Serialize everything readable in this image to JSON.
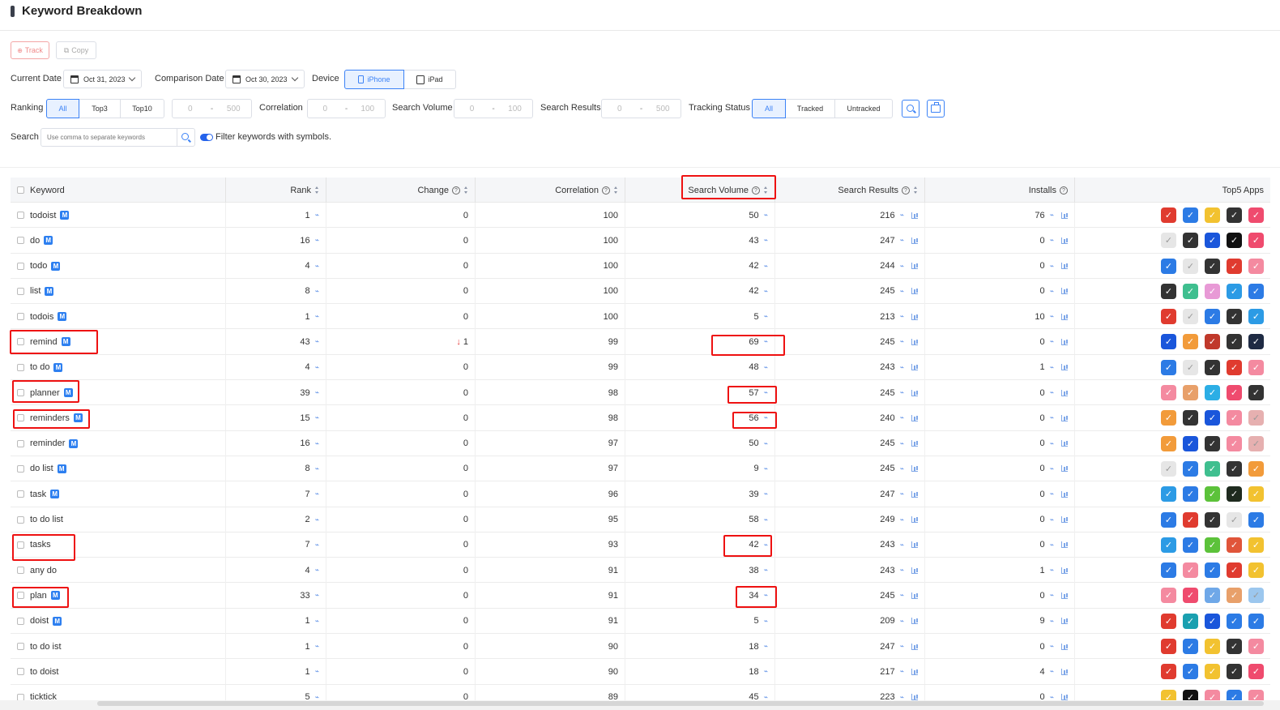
{
  "page": {
    "title": "Keyword Breakdown"
  },
  "toolbar": {
    "track_label": "Track",
    "copy_label": "Copy"
  },
  "filters": {
    "current_date_label": "Current Date",
    "current_date": "Oct 31, 2023",
    "comparison_date_label": "Comparison Date",
    "comparison_date": "Oct 30, 2023",
    "device_label": "Device",
    "device_options": [
      "iPhone",
      "iPad"
    ],
    "ranking_label": "Ranking",
    "ranking_options": [
      "All",
      "Top3",
      "Top10"
    ],
    "ranking_min": "0",
    "ranking_max": "500",
    "correlation_label": "Correlation",
    "correlation_min": "0",
    "correlation_max": "100",
    "search_volume_label": "Search Volume",
    "search_volume_min": "0",
    "search_volume_max": "100",
    "search_results_label": "Search Results",
    "search_results_min": "0",
    "search_results_max": "500",
    "tracking_status_label": "Tracking Status",
    "tracking_options": [
      "All",
      "Tracked",
      "Untracked"
    ],
    "range_dash": "-",
    "search_label": "Search",
    "search_placeholder": "Use comma to separate keywords",
    "filter_symbols_label": "Filter keywords with symbols."
  },
  "table": {
    "columns": [
      "Keyword",
      "Rank",
      "Change",
      "Correlation",
      "Search Volume",
      "Search Results",
      "Installs",
      "Top5 Apps"
    ],
    "rows": [
      {
        "keyword": "todoist",
        "m": "M",
        "rank": "1",
        "change": "0",
        "correlation": "100",
        "volume": "50",
        "results": "216",
        "installs": "76",
        "apps": [
          "#e03b2f",
          "#2c7be5",
          "#f2c230",
          "#333333",
          "#ef4b6e"
        ]
      },
      {
        "keyword": "do",
        "m": "M",
        "rank": "16",
        "change": "0",
        "correlation": "100",
        "volume": "43",
        "results": "247",
        "installs": "0",
        "apps": [
          "#e6e6e6",
          "#333333",
          "#1a56db",
          "#111111",
          "#ef4b6e"
        ]
      },
      {
        "keyword": "todo",
        "m": "M",
        "rank": "4",
        "change": "0",
        "correlation": "100",
        "volume": "42",
        "results": "244",
        "installs": "0",
        "apps": [
          "#2c7be5",
          "#e6e6e6",
          "#333333",
          "#e03b2f",
          "#f48aa0"
        ]
      },
      {
        "keyword": "list",
        "m": "M",
        "rank": "8",
        "change": "0",
        "correlation": "100",
        "volume": "42",
        "results": "245",
        "installs": "0",
        "apps": [
          "#333333",
          "#3fbf8f",
          "#e89ad6",
          "#2c9be5",
          "#2c7be5"
        ]
      },
      {
        "keyword": "todois",
        "m": "M",
        "rank": "1",
        "change": "0",
        "correlation": "100",
        "volume": "5",
        "results": "213",
        "installs": "10",
        "apps": [
          "#e03b2f",
          "#e6e6e6",
          "#2c7be5",
          "#333333",
          "#2c9be5"
        ]
      },
      {
        "keyword": "remind",
        "m": "M",
        "rank": "43",
        "change": "1",
        "change_down": "↓",
        "correlation": "99",
        "volume": "69",
        "results": "245",
        "installs": "0",
        "apps": [
          "#1a56db",
          "#f29b3a",
          "#c0392b",
          "#333333",
          "#1f2b44"
        ]
      },
      {
        "keyword": "to do",
        "m": "M",
        "rank": "4",
        "change": "0",
        "correlation": "99",
        "volume": "48",
        "results": "243",
        "installs": "1",
        "apps": [
          "#2c7be5",
          "#e6e6e6",
          "#333333",
          "#e03b2f",
          "#f48aa0"
        ]
      },
      {
        "keyword": "planner",
        "m": "M",
        "rank": "39",
        "change": "0",
        "correlation": "98",
        "volume": "57",
        "results": "245",
        "installs": "0",
        "apps": [
          "#f48aa0",
          "#e8a06a",
          "#2caee5",
          "#ef4b6e",
          "#333333"
        ]
      },
      {
        "keyword": "reminders",
        "m": "M",
        "rank": "15",
        "change": "0",
        "correlation": "98",
        "volume": "56",
        "results": "240",
        "installs": "0",
        "apps": [
          "#f29b3a",
          "#333333",
          "#1a56db",
          "#f48aa0",
          "#e6b0b0"
        ]
      },
      {
        "keyword": "reminder",
        "m": "M",
        "rank": "16",
        "change": "0",
        "correlation": "97",
        "volume": "50",
        "results": "245",
        "installs": "0",
        "apps": [
          "#f29b3a",
          "#1a56db",
          "#333333",
          "#f48aa0",
          "#e6b0b0"
        ]
      },
      {
        "keyword": "do list",
        "m": "M",
        "rank": "8",
        "change": "0",
        "correlation": "97",
        "volume": "9",
        "results": "245",
        "installs": "0",
        "apps": [
          "#e6e6e6",
          "#2c7be5",
          "#3fbf8f",
          "#333333",
          "#f29b3a"
        ]
      },
      {
        "keyword": "task",
        "m": "M",
        "rank": "7",
        "change": "0",
        "correlation": "96",
        "volume": "39",
        "results": "247",
        "installs": "0",
        "apps": [
          "#2c9be5",
          "#2c7be5",
          "#5cc23a",
          "#1f2b1f",
          "#f2c230"
        ]
      },
      {
        "keyword": "to do list",
        "m": "",
        "rank": "2",
        "change": "0",
        "correlation": "95",
        "volume": "58",
        "results": "249",
        "installs": "0",
        "apps": [
          "#2c7be5",
          "#e03b2f",
          "#333333",
          "#e6e6e6",
          "#2c7be5"
        ]
      },
      {
        "keyword": "tasks",
        "m": "",
        "rank": "7",
        "change": "0",
        "correlation": "93",
        "volume": "42",
        "results": "243",
        "installs": "0",
        "apps": [
          "#2c9be5",
          "#2c7be5",
          "#5cc23a",
          "#e0553a",
          "#f2c230"
        ]
      },
      {
        "keyword": "any do",
        "m": "",
        "rank": "4",
        "change": "0",
        "correlation": "91",
        "volume": "38",
        "results": "243",
        "installs": "1",
        "apps": [
          "#2c7be5",
          "#f48aa0",
          "#2c7be5",
          "#e03b2f",
          "#f2c230"
        ]
      },
      {
        "keyword": "plan",
        "m": "M",
        "rank": "33",
        "change": "0",
        "correlation": "91",
        "volume": "34",
        "results": "245",
        "installs": "0",
        "apps": [
          "#f48aa0",
          "#ef4b6e",
          "#6fa8e8",
          "#e8a06a",
          "#9cc7ee"
        ]
      },
      {
        "keyword": "doist",
        "m": "M",
        "rank": "1",
        "change": "0",
        "correlation": "91",
        "volume": "5",
        "results": "209",
        "installs": "9",
        "apps": [
          "#e03b2f",
          "#1aa0b0",
          "#1a56db",
          "#2c7be5",
          "#2c7be5"
        ]
      },
      {
        "keyword": "to do ist",
        "m": "",
        "rank": "1",
        "change": "0",
        "correlation": "90",
        "volume": "18",
        "results": "247",
        "installs": "0",
        "apps": [
          "#e03b2f",
          "#2c7be5",
          "#f2c230",
          "#333333",
          "#f48aa0"
        ]
      },
      {
        "keyword": "to doist",
        "m": "",
        "rank": "1",
        "change": "0",
        "correlation": "90",
        "volume": "18",
        "results": "217",
        "installs": "4",
        "apps": [
          "#e03b2f",
          "#2c7be5",
          "#f2c230",
          "#333333",
          "#ef4b6e"
        ]
      },
      {
        "keyword": "ticktick",
        "m": "",
        "rank": "5",
        "change": "0",
        "correlation": "89",
        "volume": "45",
        "results": "223",
        "installs": "0",
        "apps": [
          "#f2c230",
          "#111111",
          "#f48aa0",
          "#2c7be5",
          "#f48aa0"
        ]
      }
    ]
  }
}
